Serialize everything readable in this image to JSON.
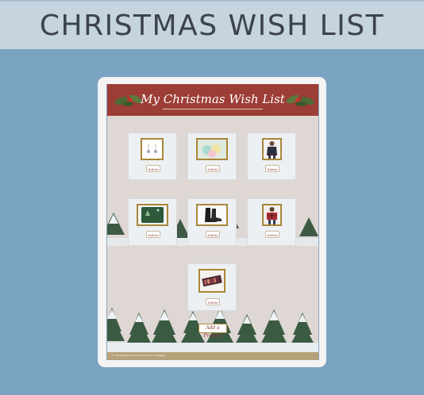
{
  "header": {
    "title": "CHRISTMAS WISH LIST"
  },
  "app": {
    "banner_title": "My Christmas Wish List",
    "items": [
      {
        "name": "earrings",
        "delete_label": "Delete"
      },
      {
        "name": "bath bombs",
        "delete_label": "Delete"
      },
      {
        "name": "sweater",
        "delete_label": "Delete"
      },
      {
        "name": "phone case",
        "delete_label": "Delete"
      },
      {
        "name": "boots",
        "delete_label": "Delete"
      },
      {
        "name": "plaid shirt",
        "delete_label": "Delete"
      },
      {
        "name": "eyeshadow palette",
        "delete_label": "Delete"
      }
    ],
    "add_label": "Add a Present",
    "footer_text": "© 2018 Brynne Cordes and some courtesies"
  },
  "colors": {
    "page_bg": "#7ba3c2",
    "topbar_bg": "#c5d4de",
    "banner_red": "#9c3d36",
    "frame_gold": "#a88739"
  }
}
